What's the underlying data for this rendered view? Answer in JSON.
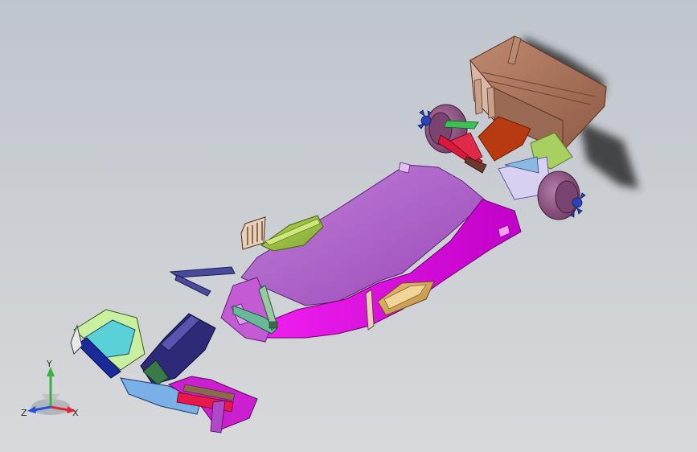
{
  "viewport": {
    "scene_name": "exploded-race-car-assembly"
  },
  "triad": {
    "x_label": "X",
    "y_label": "Y",
    "z_label": "Z",
    "colors": {
      "x": "#e0283a",
      "y": "#3cb043",
      "z": "#2a4fd6"
    }
  },
  "parts": [
    {
      "name": "rear-wing",
      "color": "#a0705a"
    },
    {
      "name": "rear-diffuser",
      "color": "#b83a10"
    },
    {
      "name": "rear-suspension-wishbones",
      "color": "#d8183c"
    },
    {
      "name": "rear-wheel-hub-left",
      "color": "#8a4a7a"
    },
    {
      "name": "rear-wheel-hub-right",
      "color": "#8a4a7a"
    },
    {
      "name": "floor-panel",
      "color": "#b15ac9"
    },
    {
      "name": "sidepod-right",
      "color": "#e100e0"
    },
    {
      "name": "engine-cover-window",
      "color": "#8fc23a"
    },
    {
      "name": "sidepod-window",
      "color": "#d9a650"
    },
    {
      "name": "cockpit-parts",
      "color": "#4a4a9a"
    },
    {
      "name": "nose-cone",
      "color": "#2e2a78"
    },
    {
      "name": "front-wing",
      "color": "#cc1fd1"
    }
  ]
}
